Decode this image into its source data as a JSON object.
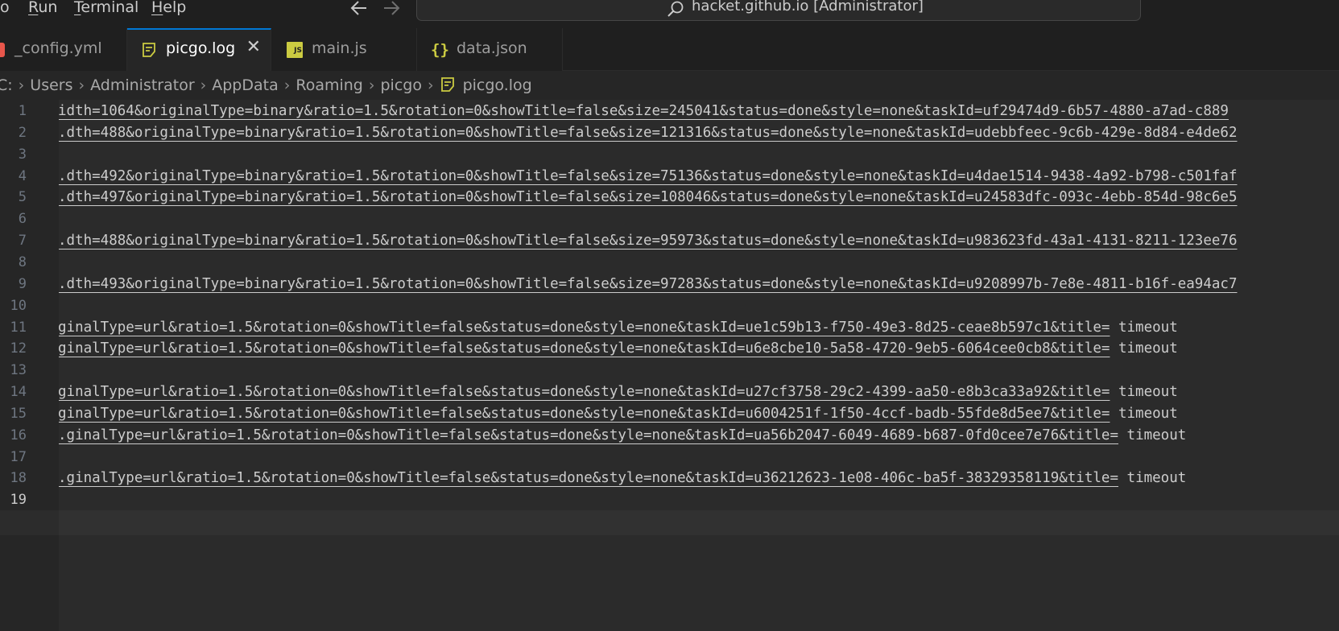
{
  "menu": {
    "partial_item": "o",
    "items": [
      {
        "label": "Run",
        "mnemonic": "R",
        "rest": "un"
      },
      {
        "label": "Terminal",
        "mnemonic": "T",
        "rest": "erminal"
      },
      {
        "label": "Help",
        "mnemonic": "H",
        "rest": "elp"
      }
    ]
  },
  "command_center": {
    "text": "hacket.github.io [Administrator]"
  },
  "tabs": [
    {
      "label": "_config.yml",
      "icon": "yaml-file-icon",
      "active": false
    },
    {
      "label": "picgo.log",
      "icon": "log-file-icon",
      "active": true
    },
    {
      "label": "main.js",
      "icon": "javascript-file-icon",
      "active": false
    },
    {
      "label": "data.json",
      "icon": "json-braces-icon",
      "active": false
    }
  ],
  "breadcrumb": [
    "C:",
    "Users",
    "Administrator",
    "AppData",
    "Roaming",
    "picgo",
    "picgo.log"
  ],
  "editor": {
    "current_line": 19,
    "lines": [
      {
        "n": "1",
        "link": "idth=1064&originalType=binary&ratio=1.5&rotation=0&showTitle=false&size=245041&status=done&style=none&taskId=uf29474d9-6b57-4880-a7ad-c889",
        "tail": ""
      },
      {
        "n": "2",
        "link": ".dth=488&originalType=binary&ratio=1.5&rotation=0&showTitle=false&size=121316&status=done&style=none&taskId=udebbfeec-9c6b-429e-8d84-e4de62",
        "tail": ""
      },
      {
        "n": "3",
        "link": "",
        "tail": ""
      },
      {
        "n": "4",
        "link": ".dth=492&originalType=binary&ratio=1.5&rotation=0&showTitle=false&size=75136&status=done&style=none&taskId=u4dae1514-9438-4a92-b798-c501faf",
        "tail": ""
      },
      {
        "n": "5",
        "link": ".dth=497&originalType=binary&ratio=1.5&rotation=0&showTitle=false&size=108046&status=done&style=none&taskId=u24583dfc-093c-4ebb-854d-98c6e5",
        "tail": ""
      },
      {
        "n": "6",
        "link": "",
        "tail": ""
      },
      {
        "n": "7",
        "link": ".dth=488&originalType=binary&ratio=1.5&rotation=0&showTitle=false&size=95973&status=done&style=none&taskId=u983623fd-43a1-4131-8211-123ee76",
        "tail": ""
      },
      {
        "n": "8",
        "link": "",
        "tail": ""
      },
      {
        "n": "9",
        "link": ".dth=493&originalType=binary&ratio=1.5&rotation=0&showTitle=false&size=97283&status=done&style=none&taskId=u9208997b-7e8e-4811-b16f-ea94ac7",
        "tail": ""
      },
      {
        "n": "10",
        "link": "",
        "tail": ""
      },
      {
        "n": "11",
        "link": "ginalType=url&ratio=1.5&rotation=0&showTitle=false&status=done&style=none&taskId=ue1c59b13-f750-49e3-8d25-ceae8b597c1&title=",
        "tail": " timeout"
      },
      {
        "n": "12",
        "link": "ginalType=url&ratio=1.5&rotation=0&showTitle=false&status=done&style=none&taskId=u6e8cbe10-5a58-4720-9eb5-6064cee0cb8&title=",
        "tail": " timeout"
      },
      {
        "n": "13",
        "link": "",
        "tail": ""
      },
      {
        "n": "14",
        "link": "ginalType=url&ratio=1.5&rotation=0&showTitle=false&status=done&style=none&taskId=u27cf3758-29c2-4399-aa50-e8b3ca33a92&title=",
        "tail": " timeout"
      },
      {
        "n": "15",
        "link": "ginalType=url&ratio=1.5&rotation=0&showTitle=false&status=done&style=none&taskId=u6004251f-1f50-4ccf-badb-55fde8d5ee7&title=",
        "tail": " timeout"
      },
      {
        "n": "16",
        "link": ".ginalType=url&ratio=1.5&rotation=0&showTitle=false&status=done&style=none&taskId=ua56b2047-6049-4689-b687-0fd0cee7e76&title=",
        "tail": " timeout"
      },
      {
        "n": "17",
        "link": "",
        "tail": ""
      },
      {
        "n": "18",
        "link": ".ginalType=url&ratio=1.5&rotation=0&showTitle=false&status=done&style=none&taskId=u36212623-1e08-406c-ba5f-38329358119&title=",
        "tail": " timeout"
      },
      {
        "n": "19",
        "link": "",
        "tail": ""
      }
    ]
  },
  "colors": {
    "background": "#262626",
    "chrome": "#1f1f1f",
    "accent": "#0078d4",
    "text": "#cccccc",
    "log_icon": "#cbcb41"
  }
}
